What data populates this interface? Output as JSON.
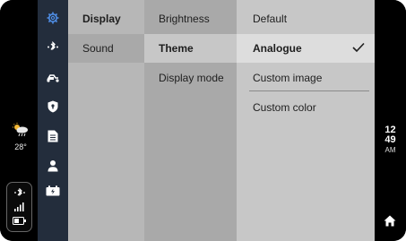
{
  "weather": {
    "temperature": "28°",
    "icon": "partly-cloudy-rain-icon"
  },
  "clock": {
    "hour": "12",
    "minute": "49",
    "ampm": "AM"
  },
  "nav_rail": {
    "icons": [
      "gear-icon",
      "bluetooth-icon",
      "scooter-icon",
      "shield-icon",
      "document-icon",
      "user-icon",
      "battery-charging-icon"
    ],
    "active": "gear-icon",
    "accent": "#4f8ee6"
  },
  "menu": {
    "categories": [
      {
        "label": "Display",
        "selected": true
      },
      {
        "label": "Sound",
        "selected": false
      }
    ],
    "display_options": [
      {
        "label": "Brightness",
        "selected": false
      },
      {
        "label": "Theme",
        "selected": true
      },
      {
        "label": "Display mode",
        "selected": false
      }
    ],
    "theme_options": [
      {
        "label": "Default",
        "selected": false
      },
      {
        "label": "Analogue",
        "selected": true
      },
      {
        "label": "Custom image",
        "selected": false
      },
      {
        "label": "Custom color",
        "selected": false
      }
    ]
  },
  "status": {
    "icons": [
      "bluetooth-icon",
      "signal-icon",
      "battery-icon"
    ]
  },
  "colors": {
    "rail": "#232d3c",
    "col1": "#b7b7b7",
    "col2": "#a9a9a9",
    "col3": "#c7c7c7",
    "selected_row": "#dddddd"
  }
}
